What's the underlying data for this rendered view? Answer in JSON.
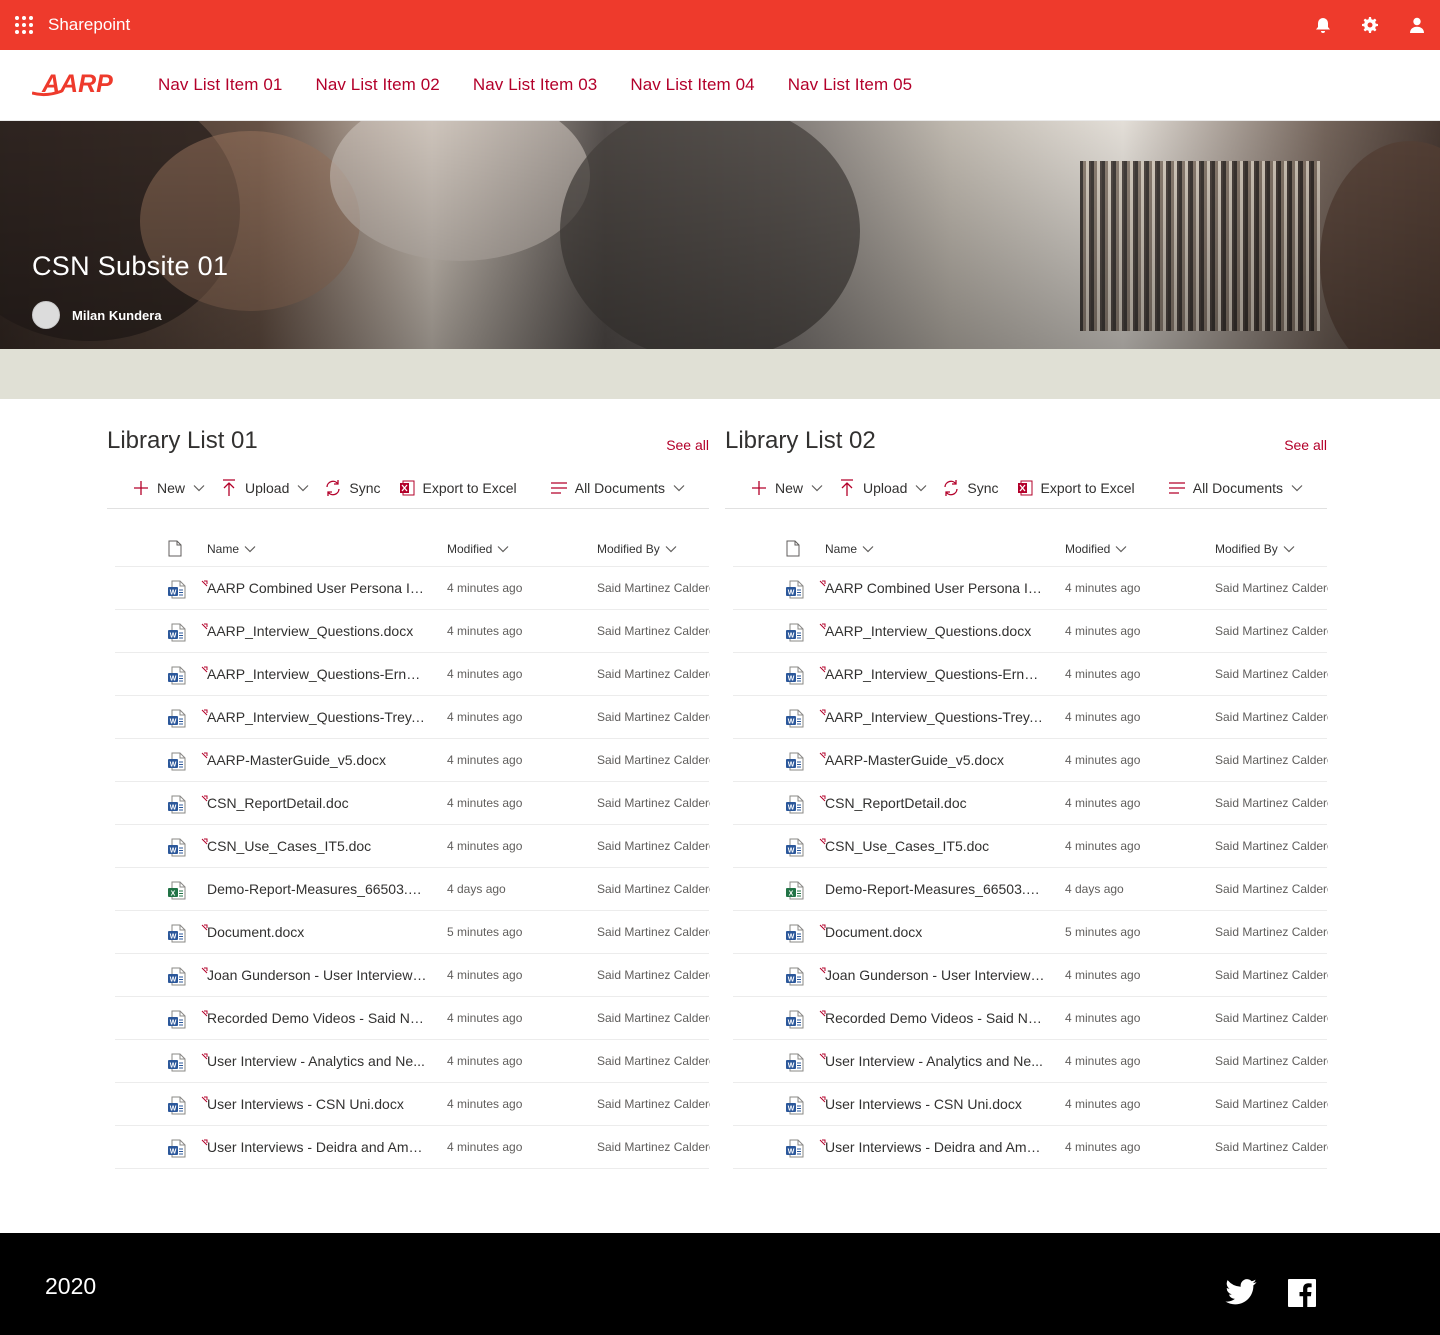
{
  "suitebar": {
    "app_name": "Sharepoint",
    "color": "#ee3a2c",
    "icons": [
      "waffle-icon",
      "bell-icon",
      "gear-icon",
      "user-icon"
    ]
  },
  "site_header": {
    "logo_text": "AARP",
    "nav": [
      "Nav List Item 01",
      "Nav List Item 02",
      "Nav List Item 03",
      "Nav List Item 04",
      "Nav List Item 05"
    ],
    "accent": "#b3002a"
  },
  "hero": {
    "title": "CSN Subsite 01",
    "owner": "Milan Kundera"
  },
  "libraries": [
    {
      "title": "Library List 01",
      "see_all": "See all",
      "commands": {
        "new": "New",
        "upload": "Upload",
        "sync": "Sync",
        "export": "Export to Excel",
        "view": "All Documents"
      },
      "columns": {
        "name": "Name",
        "modified": "Modified",
        "modified_by": "Modified By"
      },
      "rows": [
        {
          "name": "AARP Combined User Persona Int...",
          "modified": "4 minutes ago",
          "by": "Said Martinez Calderon",
          "type": "word",
          "new": true
        },
        {
          "name": "AARP_Interview_Questions.docx",
          "modified": "4 minutes ago",
          "by": "Said Martinez Calderon",
          "type": "word",
          "new": true
        },
        {
          "name": "AARP_Interview_Questions-Ernest...",
          "modified": "4 minutes ago",
          "by": "Said Martinez Calderon",
          "type": "word",
          "new": true
        },
        {
          "name": "AARP_Interview_Questions-Trey.d...",
          "modified": "4 minutes ago",
          "by": "Said Martinez Calderon",
          "type": "word",
          "new": true
        },
        {
          "name": "AARP-MasterGuide_v5.docx",
          "modified": "4 minutes ago",
          "by": "Said Martinez Calderon",
          "type": "word",
          "new": true
        },
        {
          "name": "CSN_ReportDetail.doc",
          "modified": "4 minutes ago",
          "by": "Said Martinez Calderon",
          "type": "word",
          "new": true
        },
        {
          "name": "CSN_Use_Cases_IT5.doc",
          "modified": "4 minutes ago",
          "by": "Said Martinez Calderon",
          "type": "word",
          "new": true
        },
        {
          "name": "Demo-Report-Measures_66503.xlsx",
          "modified": "4 days ago",
          "by": "Said Martinez Calderon",
          "type": "excel",
          "new": false
        },
        {
          "name": "Document.docx",
          "modified": "5 minutes ago",
          "by": "Said Martinez Calderon",
          "type": "word",
          "new": true
        },
        {
          "name": "Joan Gunderson - User Interviews...",
          "modified": "4 minutes ago",
          "by": "Said Martinez Calderon",
          "type": "word",
          "new": true
        },
        {
          "name": "Recorded Demo Videos - Said No...",
          "modified": "4 minutes ago",
          "by": "Said Martinez Calderon",
          "type": "word",
          "new": true
        },
        {
          "name": "User Interview - Analytics and Ne...",
          "modified": "4 minutes ago",
          "by": "Said Martinez Calderon",
          "type": "word",
          "new": true
        },
        {
          "name": "User Interviews - CSN Uni.docx",
          "modified": "4 minutes ago",
          "by": "Said Martinez Calderon",
          "type": "word",
          "new": true
        },
        {
          "name": "User Interviews - Deidra and Amb...",
          "modified": "4 minutes ago",
          "by": "Said Martinez Calderon",
          "type": "word",
          "new": true
        }
      ]
    },
    {
      "title": "Library List 02",
      "see_all": "See all",
      "commands": {
        "new": "New",
        "upload": "Upload",
        "sync": "Sync",
        "export": "Export to Excel",
        "view": "All Documents"
      },
      "columns": {
        "name": "Name",
        "modified": "Modified",
        "modified_by": "Modified By"
      },
      "rows": [
        {
          "name": "AARP Combined User Persona Int...",
          "modified": "4 minutes ago",
          "by": "Said Martinez Calderon",
          "type": "word",
          "new": true
        },
        {
          "name": "AARP_Interview_Questions.docx",
          "modified": "4 minutes ago",
          "by": "Said Martinez Calderon",
          "type": "word",
          "new": true
        },
        {
          "name": "AARP_Interview_Questions-Ernest...",
          "modified": "4 minutes ago",
          "by": "Said Martinez Calderon",
          "type": "word",
          "new": true
        },
        {
          "name": "AARP_Interview_Questions-Trey.d...",
          "modified": "4 minutes ago",
          "by": "Said Martinez Calderon",
          "type": "word",
          "new": true
        },
        {
          "name": "AARP-MasterGuide_v5.docx",
          "modified": "4 minutes ago",
          "by": "Said Martinez Calderon",
          "type": "word",
          "new": true
        },
        {
          "name": "CSN_ReportDetail.doc",
          "modified": "4 minutes ago",
          "by": "Said Martinez Calderon",
          "type": "word",
          "new": true
        },
        {
          "name": "CSN_Use_Cases_IT5.doc",
          "modified": "4 minutes ago",
          "by": "Said Martinez Calderon",
          "type": "word",
          "new": true
        },
        {
          "name": "Demo-Report-Measures_66503.xlsx",
          "modified": "4 days ago",
          "by": "Said Martinez Calderon",
          "type": "excel",
          "new": false
        },
        {
          "name": "Document.docx",
          "modified": "5 minutes ago",
          "by": "Said Martinez Calderon",
          "type": "word",
          "new": true
        },
        {
          "name": "Joan Gunderson - User Interviews...",
          "modified": "4 minutes ago",
          "by": "Said Martinez Calderon",
          "type": "word",
          "new": true
        },
        {
          "name": "Recorded Demo Videos - Said No...",
          "modified": "4 minutes ago",
          "by": "Said Martinez Calderon",
          "type": "word",
          "new": true
        },
        {
          "name": "User Interview - Analytics and Ne...",
          "modified": "4 minutes ago",
          "by": "Said Martinez Calderon",
          "type": "word",
          "new": true
        },
        {
          "name": "User Interviews - CSN Uni.docx",
          "modified": "4 minutes ago",
          "by": "Said Martinez Calderon",
          "type": "word",
          "new": true
        },
        {
          "name": "User Interviews - Deidra and Amb...",
          "modified": "4 minutes ago",
          "by": "Said Martinez Calderon",
          "type": "word",
          "new": true
        }
      ]
    }
  ],
  "footer": {
    "year": "2020",
    "social": [
      "twitter-icon",
      "facebook-icon"
    ]
  }
}
